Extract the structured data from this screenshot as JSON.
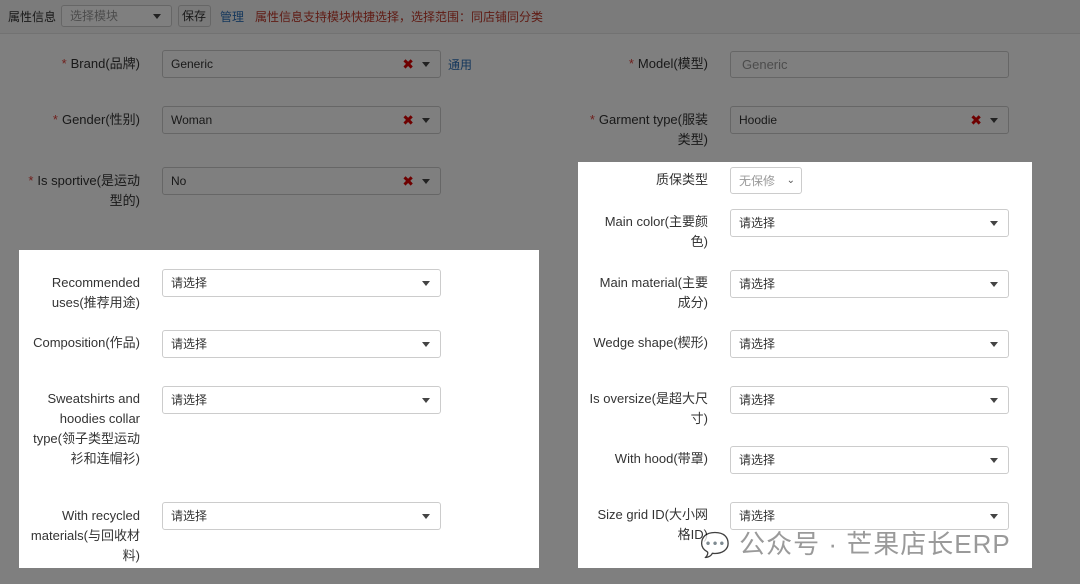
{
  "toolbar": {
    "title": "属性信息",
    "module_placeholder": "选择模块",
    "save_label": "保存",
    "manage_label": "管理",
    "hint": "属性信息支持模块快捷选择，选择范围：同店铺同分类"
  },
  "fields": {
    "brand": {
      "label": "Brand(品牌)",
      "value": "Generic",
      "link": "通用"
    },
    "gender": {
      "label": "Gender(性别)",
      "value": "Woman"
    },
    "sportive": {
      "label1": "Is sportive(是运动",
      "label2": "型的)",
      "value": "No"
    },
    "model": {
      "label": "Model(模型)",
      "value": "Generic"
    },
    "garment": {
      "label1": "Garment type(服装",
      "label2": "类型)",
      "value": "Hoodie"
    },
    "warranty": {
      "label": "质保类型",
      "value": "无保修"
    },
    "main_color": {
      "label1": "Main color(主要颜",
      "label2": "色)",
      "value": "请选择"
    },
    "main_material": {
      "label1": "Main material(主要",
      "label2": "成分)",
      "value": "请选择"
    },
    "wedge": {
      "label": "Wedge shape(楔形)",
      "value": "请选择"
    },
    "oversize": {
      "label1": "Is oversize(是超大尺",
      "label2": "寸)",
      "value": "请选择"
    },
    "hood": {
      "label": "With hood(带罩)",
      "value": "请选择"
    },
    "size_grid": {
      "label1": "Size grid ID(大小网",
      "label2": "格ID)",
      "value": "请选择"
    },
    "uses": {
      "label1": "Recommended",
      "label2": "uses(推荐用途)",
      "value": "请选择"
    },
    "composition": {
      "label": "Composition(作品)",
      "value": "请选择"
    },
    "collar": {
      "label1": "Sweatshirts and",
      "label2": "hoodies collar",
      "label3": "type(领子类型运动",
      "label4": "衫和连帽衫)",
      "value": "请选择"
    },
    "recycled": {
      "label1": "With recycled",
      "label2": "materials(与回收材",
      "label3": "料)",
      "value": "请选择"
    }
  },
  "required_mark": "*",
  "watermark": "公众号 · 芒果店长ERP"
}
